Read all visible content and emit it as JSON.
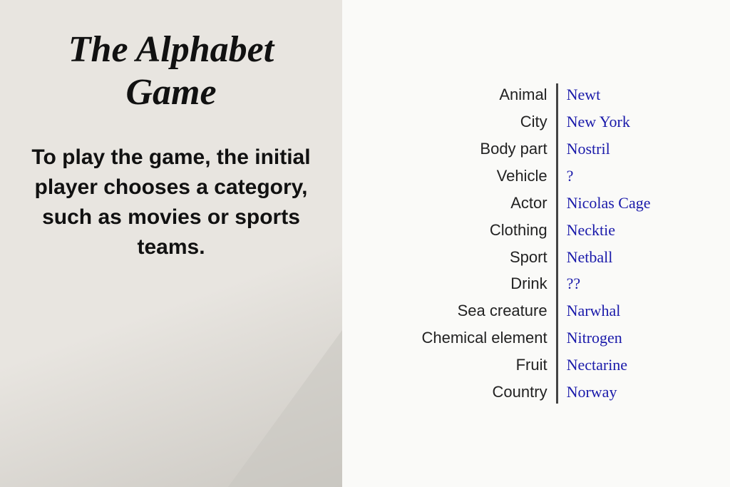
{
  "left": {
    "title": "The Alphabet Game",
    "description": "To play the game, the initial player chooses a category, such as movies or sports teams."
  },
  "right": {
    "rows": [
      {
        "category": "Animal",
        "answer": "Newt",
        "unknown": false
      },
      {
        "category": "City",
        "answer": "New York",
        "unknown": false
      },
      {
        "category": "Body part",
        "answer": "Nostril",
        "unknown": false
      },
      {
        "category": "Vehicle",
        "answer": "?",
        "unknown": true
      },
      {
        "category": "Actor",
        "answer": "Nicolas Cage",
        "unknown": false
      },
      {
        "category": "Clothing",
        "answer": "Necktie",
        "unknown": false
      },
      {
        "category": "Sport",
        "answer": "Netball",
        "unknown": false
      },
      {
        "category": "Drink",
        "answer": "??",
        "unknown": true
      },
      {
        "category": "Sea creature",
        "answer": "Narwhal",
        "unknown": false
      },
      {
        "category": "Chemical element",
        "answer": "Nitrogen",
        "unknown": false
      },
      {
        "category": "Fruit",
        "answer": "Nectarine",
        "unknown": false
      },
      {
        "category": "Country",
        "answer": "Norway",
        "unknown": false
      }
    ]
  }
}
